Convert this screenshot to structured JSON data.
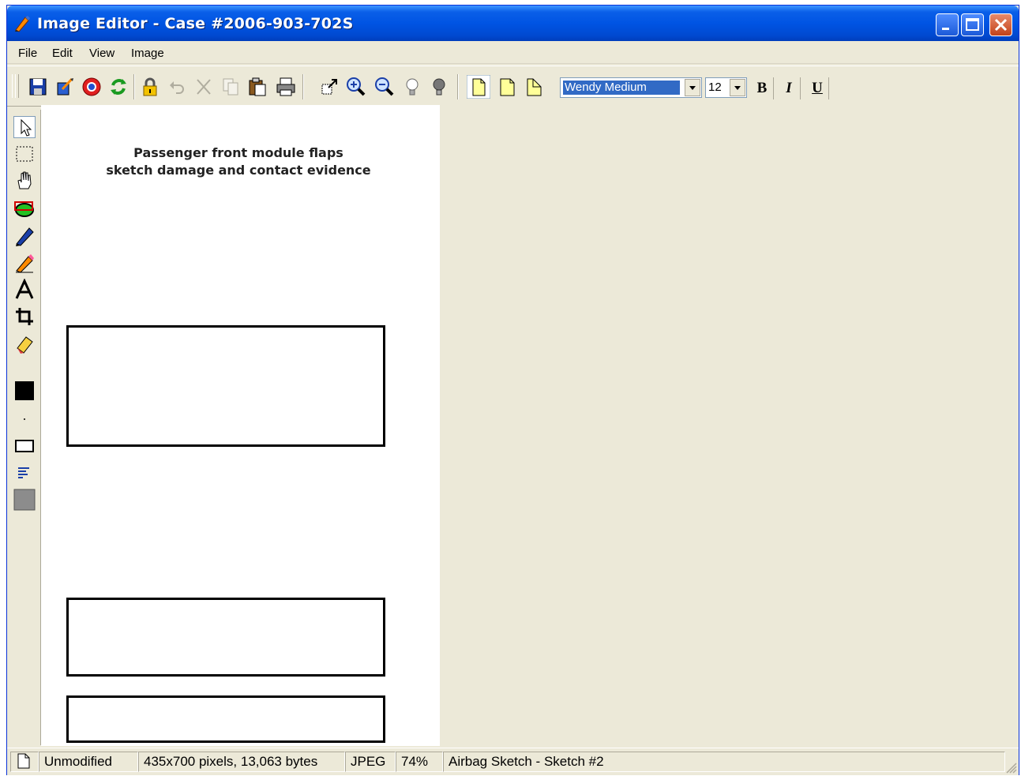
{
  "window": {
    "title": "Image Editor - Case #2006-903-702S",
    "colors": {
      "titlebar": "#0054e3",
      "chrome": "#ece9d8",
      "close": "#c3421a"
    }
  },
  "menu": [
    "File",
    "Edit",
    "View",
    "Image"
  ],
  "toolbar": {
    "icons": [
      "save-icon",
      "export-icon",
      "help-icon",
      "refresh-icon",
      "lock-icon",
      "undo-icon",
      "cut-icon",
      "copy-icon",
      "paste-icon",
      "print-icon",
      "resize-icon",
      "zoom-in-icon",
      "zoom-out-icon",
      "lightbulb-off-icon",
      "lightbulb-on-icon",
      "page-icon",
      "page-corner-icon",
      "page-fold-icon"
    ],
    "font": "Wendy Medium",
    "size": "12",
    "bold": "B",
    "italic": "I",
    "underline": "U"
  },
  "left_tools": [
    "pointer-icon",
    "rect-select-icon",
    "hand-icon",
    "ellipse-icon",
    "pen-icon",
    "pencil-icon",
    "text-tool-icon",
    "crop-icon",
    "eraser-icon",
    "color-swatch-icon",
    "dot-size-icon",
    "rectangle-shape-icon",
    "align-text-icon",
    "fill-swatch-icon"
  ],
  "document": {
    "heading_line1": "Passenger front module flaps",
    "heading_line2": "sketch damage and contact evidence"
  },
  "status": {
    "state": "Unmodified",
    "dimensions": "435x700 pixels, 13,063 bytes",
    "format": "JPEG",
    "zoom": "74%",
    "name": "Airbag Sketch - Sketch #2"
  }
}
